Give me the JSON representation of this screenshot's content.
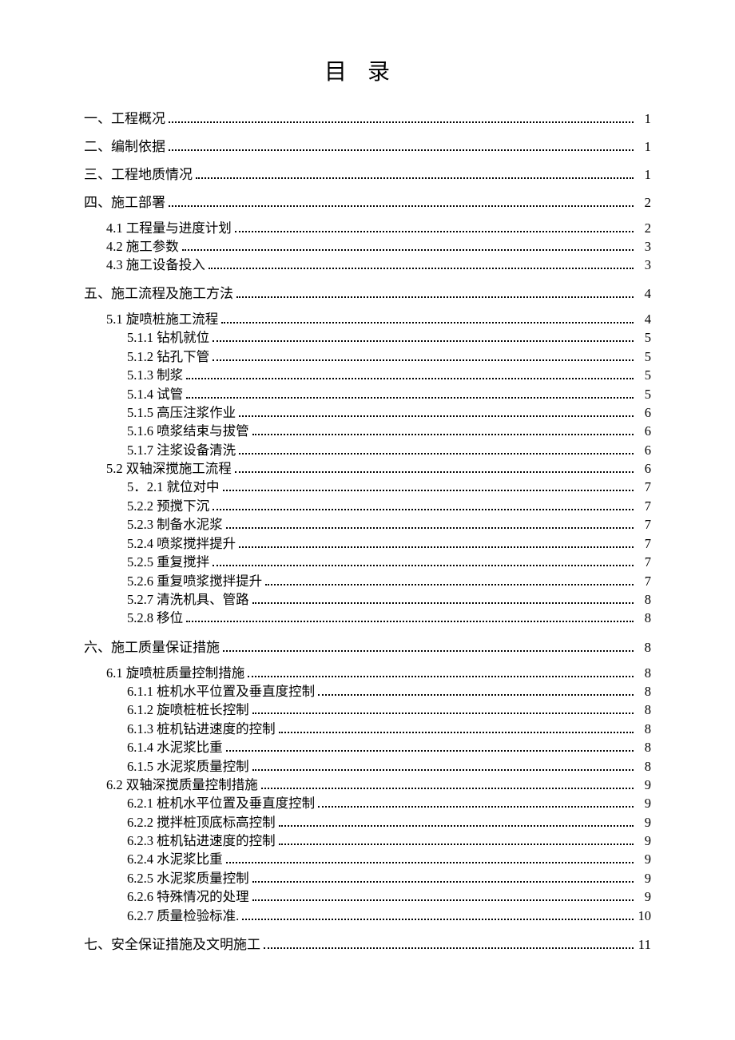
{
  "title": "目录",
  "entries": [
    {
      "level": 1,
      "label": "一、工程概况",
      "page": "1"
    },
    {
      "level": 1,
      "label": "二、编制依据",
      "page": "1"
    },
    {
      "level": 1,
      "label": "三、工程地质情况",
      "page": "1"
    },
    {
      "level": 1,
      "label": "四、施工部署",
      "page": "2"
    },
    {
      "level": 2,
      "label": "4.1 工程量与进度计划",
      "page": "2"
    },
    {
      "level": 2,
      "label": "4.2 施工参数",
      "page": "3"
    },
    {
      "level": 2,
      "label": "4.3 施工设备投入",
      "page": "3"
    },
    {
      "level": 1,
      "label": "五、施工流程及施工方法",
      "page": "4"
    },
    {
      "level": 2,
      "label": "5.1 旋喷桩施工流程",
      "page": "4"
    },
    {
      "level": 3,
      "label": "5.1.1 钻机就位",
      "page": "5"
    },
    {
      "level": 3,
      "label": "5.1.2 钻孔下管",
      "page": "5"
    },
    {
      "level": 3,
      "label": "5.1.3 制浆",
      "page": "5"
    },
    {
      "level": 3,
      "label": "5.1.4 试管",
      "page": "5"
    },
    {
      "level": 3,
      "label": "5.1.5 高压注浆作业",
      "page": "6"
    },
    {
      "level": 3,
      "label": "5.1.6 喷浆结束与拔管",
      "page": "6"
    },
    {
      "level": 3,
      "label": "5.1.7 注浆设备清洗",
      "page": "6"
    },
    {
      "level": 2,
      "label": "5.2 双轴深搅施工流程",
      "page": "6"
    },
    {
      "level": 3,
      "label": "5．2.1 就位对中",
      "page": "7"
    },
    {
      "level": 3,
      "label": "5.2.2 预搅下沉",
      "page": "7"
    },
    {
      "level": 3,
      "label": "5.2.3 制备水泥浆",
      "page": "7"
    },
    {
      "level": 3,
      "label": "5.2.4 喷浆搅拌提升",
      "page": "7"
    },
    {
      "level": 3,
      "label": "5.2.5 重复搅拌",
      "page": "7"
    },
    {
      "level": 3,
      "label": "5.2.6 重复喷浆搅拌提升",
      "page": "7"
    },
    {
      "level": 3,
      "label": "5.2.7 清洗机具、管路",
      "page": "8"
    },
    {
      "level": 3,
      "label": "5.2.8 移位",
      "page": "8"
    },
    {
      "level": 1,
      "label": "六、施工质量保证措施",
      "page": "8"
    },
    {
      "level": 2,
      "label": "6.1 旋喷桩质量控制措施",
      "page": "8"
    },
    {
      "level": 3,
      "label": "6.1.1 桩机水平位置及垂直度控制",
      "page": "8"
    },
    {
      "level": 3,
      "label": "6.1.2 旋喷桩桩长控制",
      "page": "8"
    },
    {
      "level": 3,
      "label": "6.1.3 桩机钻进速度的控制",
      "page": "8"
    },
    {
      "level": 3,
      "label": "6.1.4 水泥浆比重",
      "page": "8"
    },
    {
      "level": 3,
      "label": "6.1.5 水泥浆质量控制",
      "page": "8"
    },
    {
      "level": 2,
      "label": "6.2 双轴深搅质量控制措施",
      "page": "9"
    },
    {
      "level": 3,
      "label": "6.2.1 桩机水平位置及垂直度控制",
      "page": "9"
    },
    {
      "level": 3,
      "label": "6.2.2 搅拌桩顶底标高控制",
      "page": "9"
    },
    {
      "level": 3,
      "label": "6.2.3 桩机钻进速度的控制",
      "page": "9"
    },
    {
      "level": 3,
      "label": "6.2.4 水泥浆比重",
      "page": "9"
    },
    {
      "level": 3,
      "label": "6.2.5 水泥浆质量控制",
      "page": "9"
    },
    {
      "level": 3,
      "label": "6.2.6 特殊情况的处理",
      "page": "9"
    },
    {
      "level": 3,
      "label": "6.2.7 质量检验标准.",
      "page": "10"
    },
    {
      "level": 1,
      "label": "七、安全保证措施及文明施工",
      "page": "11"
    }
  ]
}
